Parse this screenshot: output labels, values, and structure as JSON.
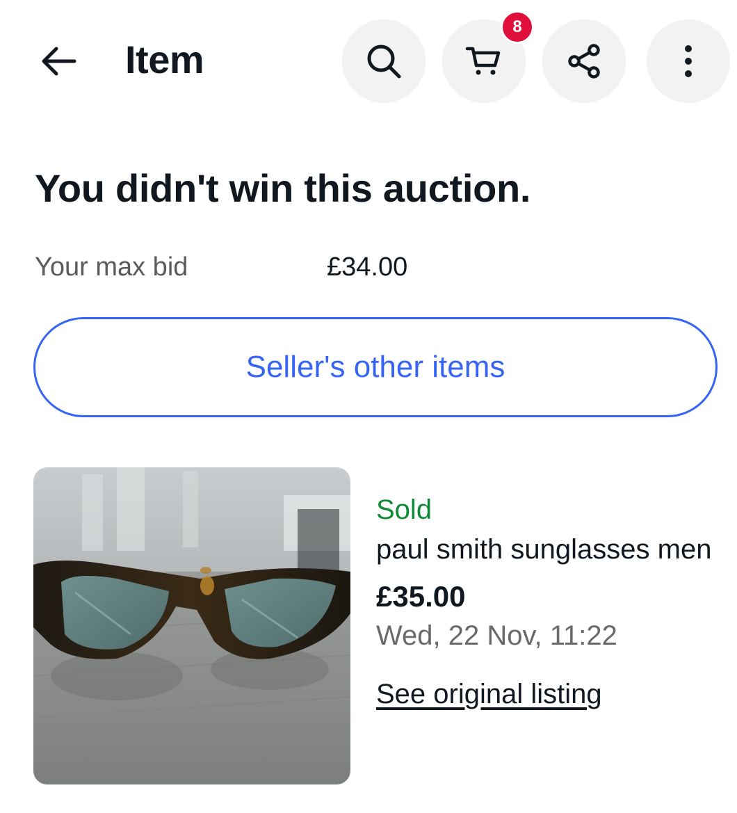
{
  "header": {
    "title": "Item",
    "cart_count": "8",
    "icons": {
      "back": "arrow-left-icon",
      "search": "search-icon",
      "cart": "cart-icon",
      "share": "share-icon",
      "more": "more-vertical-icon"
    }
  },
  "auction": {
    "headline": "You didn't win this auction.",
    "max_bid_label": "Your max bid",
    "max_bid_value": "£34.00"
  },
  "seller_button": {
    "label": "Seller's other items"
  },
  "item": {
    "status": "Sold",
    "title": "paul smith sunglasses men",
    "price": "£35.00",
    "date": "Wed, 22 Nov, 11:22",
    "link_label": "See original listing",
    "image": "sunglasses-photo"
  },
  "colors": {
    "accent_blue": "#3665f3",
    "sold_green": "#118a38",
    "badge_red": "#e0103a",
    "circle_bg": "#f2f2f2"
  }
}
